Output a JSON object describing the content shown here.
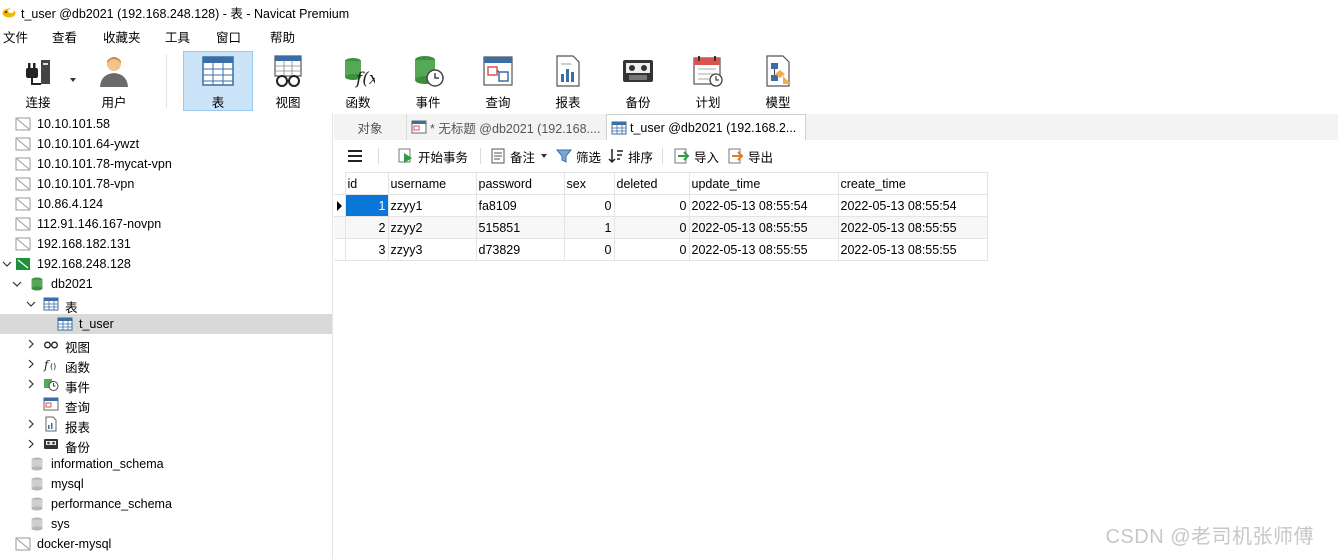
{
  "window": {
    "title": "t_user @db2021 (192.168.248.128) - 表 - Navicat Premium"
  },
  "menu": [
    "文件",
    "查看",
    "收藏夹",
    "工具",
    "窗口",
    "帮助"
  ],
  "toolbar": {
    "connect": "连接",
    "user": "用户",
    "table": "表",
    "view": "视图",
    "function": "函数",
    "event": "事件",
    "query": "查询",
    "report": "报表",
    "backup": "备份",
    "schedule": "计划",
    "model": "模型"
  },
  "sidebar": {
    "connections": [
      "10.10.101.58",
      "10.10.101.64-ywzt",
      "10.10.101.78-mycat-vpn",
      "10.10.101.78-vpn",
      "10.86.4.124",
      "112.91.146.167-novpn",
      "192.168.182.131",
      "192.168.248.128"
    ],
    "database": "db2021",
    "tables_folder": "表",
    "table_item": "t_user",
    "views": "视图",
    "functions": "函数",
    "events": "事件",
    "queries": "查询",
    "reports": "报表",
    "backups": "备份",
    "other_dbs": [
      "information_schema",
      "mysql",
      "performance_schema",
      "sys"
    ],
    "next_connection": "docker-mysql"
  },
  "tabs": {
    "objects": "对象",
    "untitled": "* 无标题 @db2021 (192.168....",
    "current": "t_user @db2021 (192.168.2..."
  },
  "grid_toolbar": {
    "begin_transaction": "开始事务",
    "notes": "备注",
    "filter": "筛选",
    "sort": "排序",
    "import": "导入",
    "export": "导出"
  },
  "table": {
    "columns": [
      "id",
      "username",
      "password",
      "sex",
      "deleted",
      "update_time",
      "create_time"
    ],
    "rows": [
      [
        "1",
        "zzyy1",
        "fa8109",
        "0",
        "0",
        "2022-05-13 08:55:54",
        "2022-05-13 08:55:54"
      ],
      [
        "2",
        "zzyy2",
        "515851",
        "1",
        "0",
        "2022-05-13 08:55:55",
        "2022-05-13 08:55:55"
      ],
      [
        "3",
        "zzyy3",
        "d73829",
        "0",
        "0",
        "2022-05-13 08:55:55",
        "2022-05-13 08:55:55"
      ]
    ]
  },
  "watermark": "CSDN @老司机张师傅",
  "colors": {
    "selection": "#0a76d8",
    "active_toolbar": "#cce4f7"
  }
}
